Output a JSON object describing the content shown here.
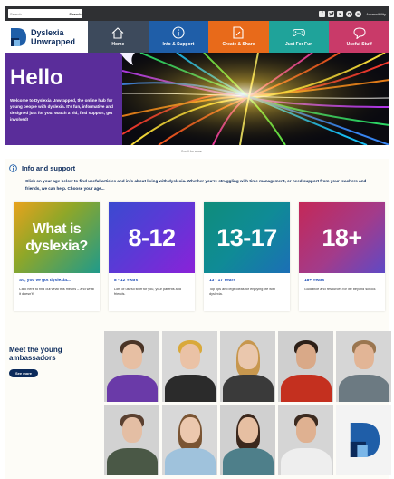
{
  "search": {
    "placeholder": "Search...",
    "button_label": "Search"
  },
  "social_icons": [
    "facebook-icon",
    "twitter-icon",
    "youtube-icon",
    "instagram-icon",
    "spotify-icon"
  ],
  "accessibility_label": "Accessibility",
  "brand": {
    "line1": "Dyslexia",
    "line2": "Unwrapped"
  },
  "nav": [
    {
      "label": "Home",
      "icon": "home-icon",
      "color": "#3d4a5c"
    },
    {
      "label": "Info & Support",
      "icon": "info-icon",
      "color": "#1f5ea8"
    },
    {
      "label": "Create & Share",
      "icon": "document-edit-icon",
      "color": "#e86a1a"
    },
    {
      "label": "Just For Fun",
      "icon": "gamepad-icon",
      "color": "#1fa39a"
    },
    {
      "label": "Useful Stuff",
      "icon": "speech-bubble-icon",
      "color": "#c93a69"
    }
  ],
  "hero": {
    "title": "Hello",
    "text": "Welcome to Dyslexia Unwrapped, the online hub for young people with dyslexia. It's fun, informative and designed just for you. Watch a vid, find support, get involved!"
  },
  "scroll_hint": "Scroll for more",
  "info": {
    "title": "Info and support",
    "intro": "Click on your age below to find useful articles and info about living with dyslexia. Whether you're struggling with time management, or need support from your teachers and friends, we can help. Choose your age...",
    "cards": [
      {
        "big_line1": "What is",
        "big_line2": "dyslexia?",
        "title": "So, you've got dyslexia...",
        "text": "Click here to find out what this means – and what it doesn't!"
      },
      {
        "big_line1": "8-12",
        "big_line2": "",
        "title": "8 - 12 Years",
        "text": "Lots of useful stuff for you, your parents and friends."
      },
      {
        "big_line1": "13-17",
        "big_line2": "",
        "title": "13 - 17 Years",
        "text": "Top tips and legit ideas for enjoying life with dyslexia."
      },
      {
        "big_line1": "18+",
        "big_line2": "",
        "title": "18+ Years",
        "text": "Guidance and resources for life beyond school."
      }
    ]
  },
  "ambassadors": {
    "title": "Meet the young ambassadors",
    "button_label": "See more"
  },
  "colors": {
    "hero_panel": "#5a2d9a",
    "navy": "#0b2a5b",
    "topbar": "#2f3033"
  }
}
